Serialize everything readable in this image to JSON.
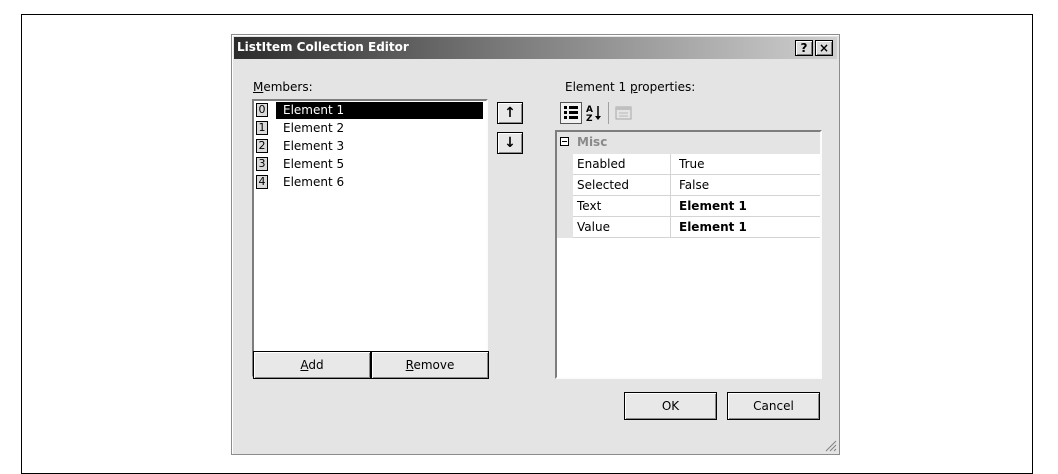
{
  "dialog": {
    "title": "ListItem Collection Editor",
    "help_button": "?",
    "close_button": "×"
  },
  "members": {
    "label_prefix": "",
    "label_accel": "M",
    "label_rest": "embers:",
    "items": [
      {
        "index": "0",
        "label": "Element 1",
        "selected": true
      },
      {
        "index": "1",
        "label": "Element 2",
        "selected": false
      },
      {
        "index": "2",
        "label": "Element 3",
        "selected": false
      },
      {
        "index": "3",
        "label": "Element 5",
        "selected": false
      },
      {
        "index": "4",
        "label": "Element 6",
        "selected": false
      }
    ]
  },
  "move_buttons": {
    "up": "↑",
    "down": "↓"
  },
  "buttons": {
    "add_accel": "A",
    "add_rest": "dd",
    "remove_accel": "R",
    "remove_rest": "emove",
    "ok": "OK",
    "cancel": "Cancel"
  },
  "properties": {
    "label_prefix": "Element 1 ",
    "label_accel": "p",
    "label_rest": "roperties:",
    "toolbar": {
      "categorized_icon": "categorized-icon",
      "alphabetical_icon": "alphabetical-icon",
      "property_pages_icon": "property-pages-icon"
    },
    "category": "Misc",
    "rows": [
      {
        "name": "Enabled",
        "value": "True",
        "bold": false
      },
      {
        "name": "Selected",
        "value": "False",
        "bold": false
      },
      {
        "name": "Text",
        "value": "Element 1",
        "bold": true
      },
      {
        "name": "Value",
        "value": "Element 1",
        "bold": true
      }
    ]
  }
}
